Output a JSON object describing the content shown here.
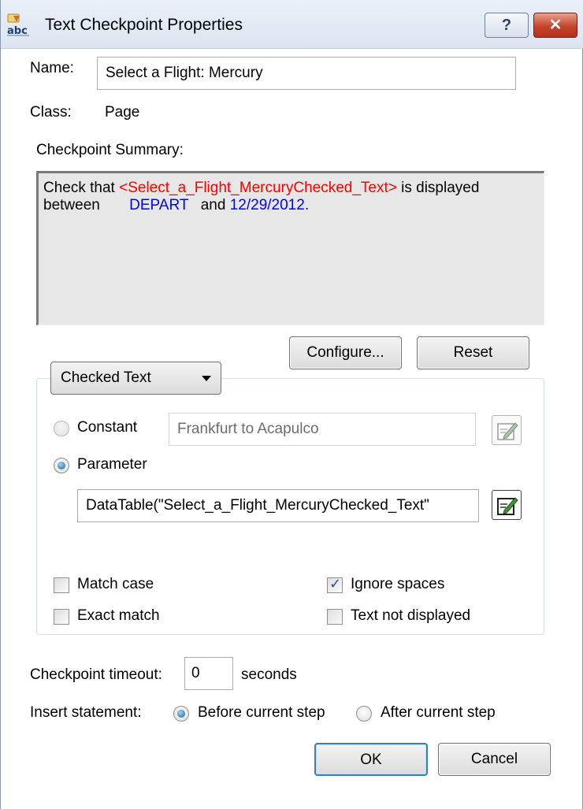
{
  "window": {
    "title": "Text Checkpoint Properties",
    "help_label": "?",
    "close_label": "✕"
  },
  "name": {
    "label": "Name:",
    "value": "Select a Flight: Mercury"
  },
  "class": {
    "label": "Class:",
    "value": "Page"
  },
  "summary": {
    "label": "Checkpoint Summary:",
    "part1": "Check that ",
    "param": "<Select_a_Flight_MercuryChecked_Text>",
    "part2": " is displayed",
    "part3": "between ",
    "start": "DEPART",
    "part4": " and ",
    "end": "12/29/2012",
    "part5": "."
  },
  "buttons": {
    "configure": "Configure...",
    "reset": "Reset",
    "ok": "OK",
    "cancel": "Cancel"
  },
  "checked_text": {
    "dropdown": "Checked Text",
    "constant_label": "Constant",
    "constant_value": "Frankfurt to Acapulco",
    "parameter_label": "Parameter",
    "parameter_value": "DataTable(\"Select_a_Flight_MercuryChecked_Text\"",
    "selected": "Parameter"
  },
  "options": {
    "match_case": {
      "label": "Match case",
      "checked": false
    },
    "ignore_spaces": {
      "label": "Ignore spaces",
      "checked": true
    },
    "exact_match": {
      "label": "Exact match",
      "checked": false
    },
    "text_not_displayed": {
      "label": "Text not displayed",
      "checked": false
    }
  },
  "timeout": {
    "label": "Checkpoint timeout:",
    "value": "0",
    "unit": "seconds"
  },
  "insert": {
    "label": "Insert statement:",
    "before": "Before current step",
    "after": "After current step",
    "selected": "Before current step"
  },
  "colors": {
    "param_text": "#ff0000",
    "bound_text": "#0000ff",
    "accent": "#3c7fb1"
  }
}
